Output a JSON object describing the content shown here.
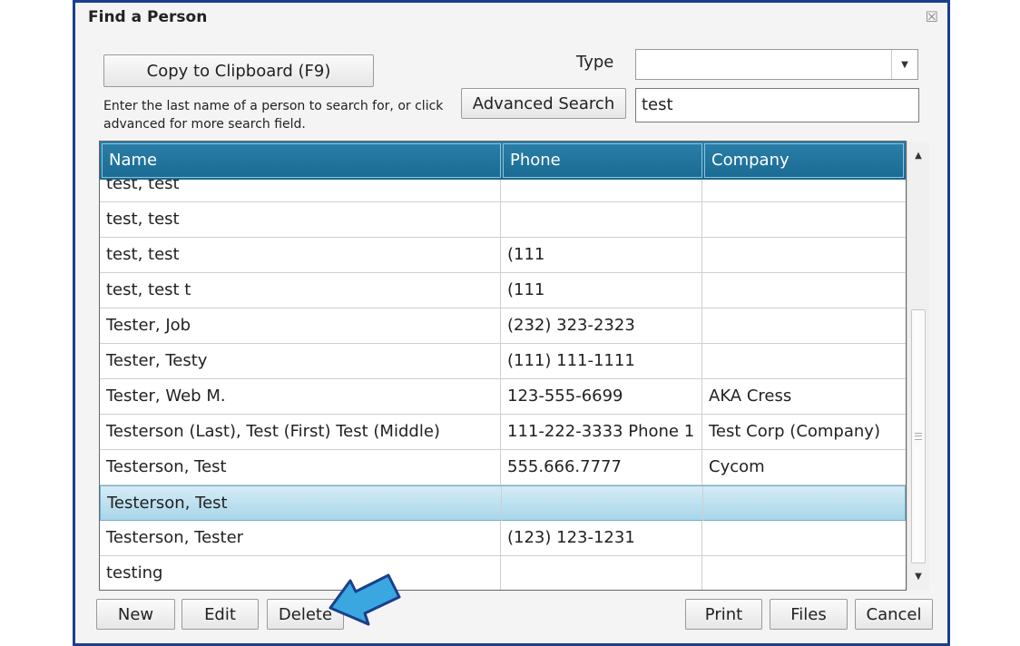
{
  "window": {
    "title": "Find a Person",
    "close_glyph": "☒"
  },
  "toolbar": {
    "copy_label": "Copy to Clipboard (F9)",
    "hint": "Enter the last name of a person to search for, or click advanced for more search field.",
    "advanced_label": "Advanced Search",
    "type_label": "Type",
    "type_value": "",
    "search_value": "test"
  },
  "grid": {
    "columns": [
      "Name",
      "Phone",
      "Company"
    ],
    "rows": [
      {
        "name": "test, test",
        "phone": "",
        "company": ""
      },
      {
        "name": "test, test",
        "phone": "",
        "company": ""
      },
      {
        "name": "test, test",
        "phone": "(111",
        "company": ""
      },
      {
        "name": "test, test t",
        "phone": "(111",
        "company": ""
      },
      {
        "name": "Tester, Job",
        "phone": "(232) 323-2323",
        "company": ""
      },
      {
        "name": "Tester, Testy",
        "phone": "(111) 111-1111",
        "company": ""
      },
      {
        "name": "Tester, Web M.",
        "phone": "123-555-6699",
        "company": "AKA Cress"
      },
      {
        "name": "Testerson (Last), Test (First) Test (Middle)",
        "phone": "111-222-3333 Phone 1",
        "company": "Test Corp (Company)"
      },
      {
        "name": "Testerson, Test",
        "phone": "555.666.7777",
        "company": "Cycom"
      },
      {
        "name": "Testerson, Test",
        "phone": "",
        "company": "",
        "selected": true
      },
      {
        "name": "Testerson, Tester",
        "phone": "(123) 123-1231",
        "company": ""
      },
      {
        "name": "testing",
        "phone": "",
        "company": ""
      }
    ]
  },
  "footer": {
    "new_label": "New",
    "edit_label": "Edit",
    "delete_label": "Delete",
    "print_label": "Print",
    "files_label": "Files",
    "cancel_label": "Cancel"
  },
  "colors": {
    "frame_border": "#1a3f8c",
    "header_bg": "#1a6a93",
    "selected_row": "#a8d6e9",
    "callout_arrow": "#3aa7e0"
  },
  "icons": {
    "dropdown": "chevron-down-icon",
    "callout": "arrow-pointer-icon"
  }
}
